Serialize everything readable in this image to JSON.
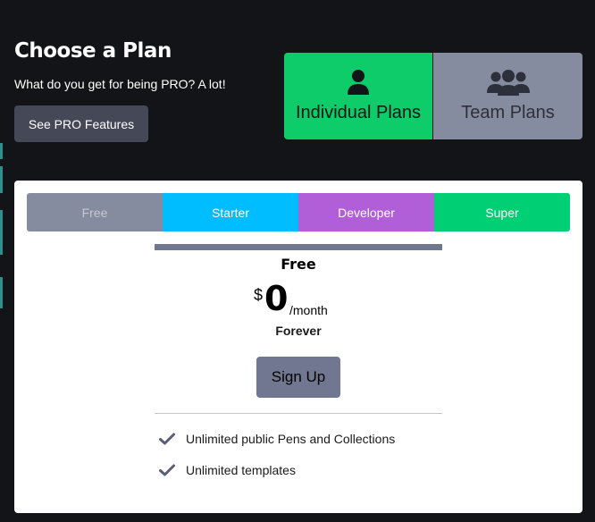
{
  "header": {
    "title": "Choose a Plan",
    "subtitle": "What do you get for being PRO? A lot!",
    "pro_button": "See PRO Features"
  },
  "plan_types": [
    {
      "label": "Individual Plans",
      "icon": "person-icon",
      "selected": true,
      "color": "#0ecc6a"
    },
    {
      "label": "Team Plans",
      "icon": "team-icon",
      "selected": false,
      "color": "#868ca0"
    }
  ],
  "tiers": [
    {
      "label": "Free",
      "color": "#868ca0",
      "selected": true
    },
    {
      "label": "Starter",
      "color": "#00bdff"
    },
    {
      "label": "Developer",
      "color": "#b15ed9"
    },
    {
      "label": "Super",
      "color": "#00cf73"
    }
  ],
  "plan": {
    "name": "Free",
    "currency": "$",
    "amount": "0",
    "per": "/month",
    "period": "Forever",
    "cta": "Sign Up",
    "features": [
      "Unlimited public Pens and Collections",
      "Unlimited templates"
    ]
  }
}
